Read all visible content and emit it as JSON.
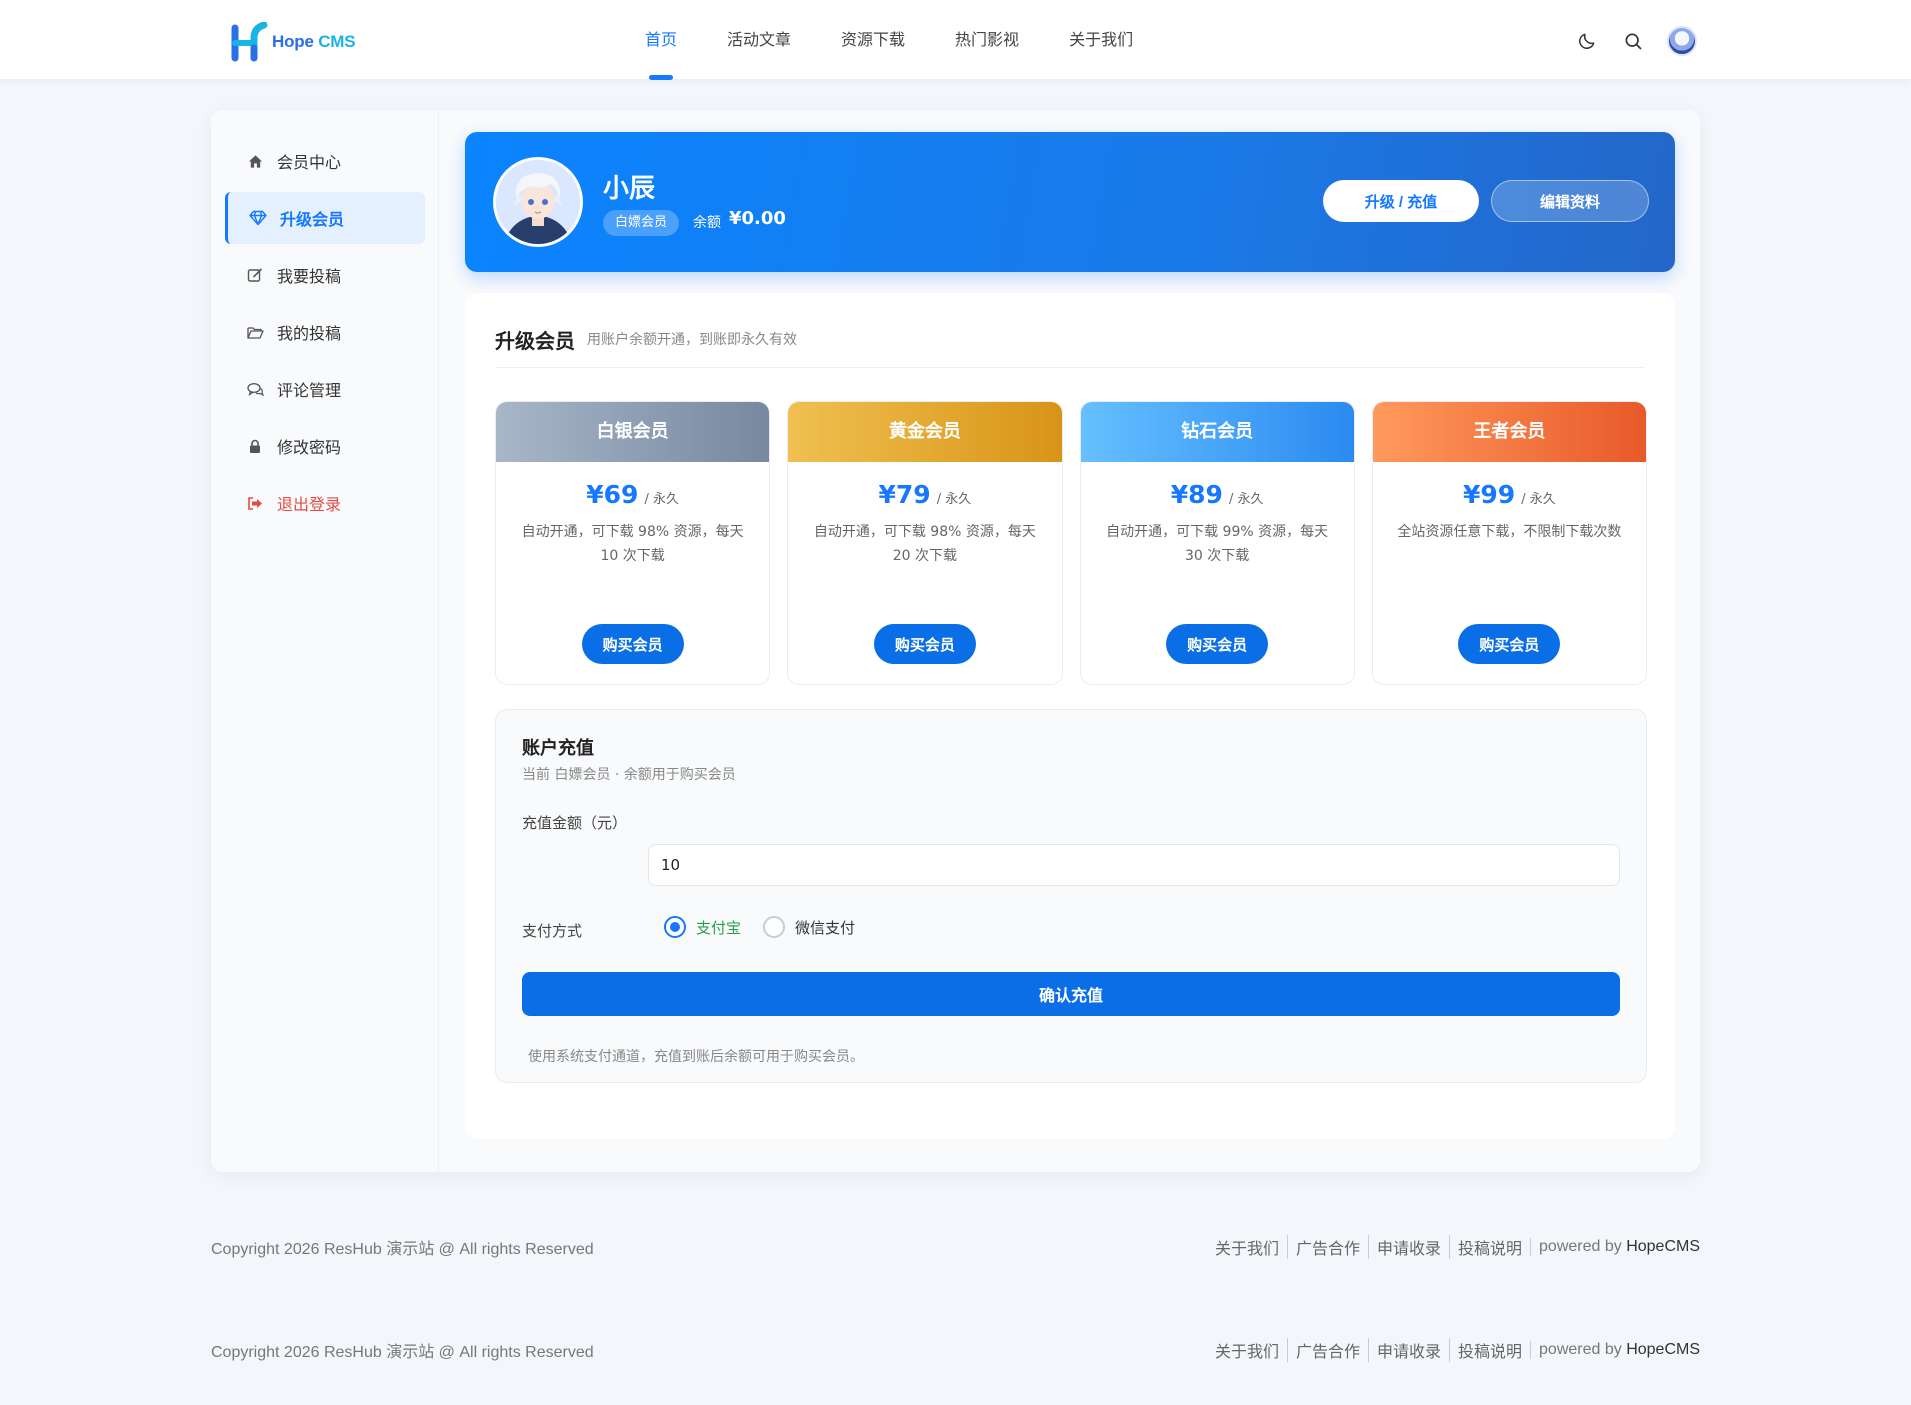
{
  "brand": {
    "logo_primary": "Hope",
    "logo_secondary": "CMS",
    "colors": {
      "primary": "#1677ff",
      "logo_blue": "#2a6ee8",
      "logo_cyan": "#18b4e6"
    }
  },
  "nav": {
    "items": [
      {
        "label": "首页",
        "active": true
      },
      {
        "label": "活动文章"
      },
      {
        "label": "资源下载"
      },
      {
        "label": "热门影视"
      },
      {
        "label": "关于我们"
      }
    ],
    "tools": {
      "theme_icon": "moon-icon",
      "search_icon": "search-icon",
      "avatar_icon": "user-avatar"
    }
  },
  "sidebar": {
    "items": [
      {
        "label": "会员中心",
        "icon": "home-icon"
      },
      {
        "label": "升级会员",
        "icon": "diamond-icon",
        "active": true
      },
      {
        "label": "我要投稿",
        "icon": "edit-icon"
      },
      {
        "label": "我的投稿",
        "icon": "folder-icon"
      },
      {
        "label": "评论管理",
        "icon": "comment-icon"
      },
      {
        "label": "修改密码",
        "icon": "lock-icon"
      },
      {
        "label": "退出登录",
        "icon": "logout-icon"
      }
    ]
  },
  "profile": {
    "name": "小辰",
    "badge": "白嫖会员",
    "balance_label": "余额",
    "balance": "¥0.00",
    "upgrade_button": "升级 / 充值",
    "edit_button": "编辑资料"
  },
  "upgrade": {
    "title": "升级会员",
    "subtitle": "用账户余额开通，到账即永久有效",
    "plans": [
      {
        "name": "白银会员",
        "price": "¥69",
        "period": "/ 永久",
        "desc": "自动开通，可下载 98% 资源，每天 10 次下载",
        "button": "购买会员",
        "gradient": [
          "#a8b6c8",
          "#7788a0"
        ]
      },
      {
        "name": "黄金会员",
        "price": "¥79",
        "period": "/ 永久",
        "desc": "自动开通，可下载 98% 资源，每天 20 次下载",
        "button": "购买会员",
        "gradient": [
          "#f0c050",
          "#d89418"
        ]
      },
      {
        "name": "钻石会员",
        "price": "¥89",
        "period": "/ 永久",
        "desc": "自动开通，可下载 99% 资源，每天 30 次下载",
        "button": "购买会员",
        "gradient": [
          "#66c0ff",
          "#2b8af0"
        ]
      },
      {
        "name": "王者会员",
        "price": "¥99",
        "period": "/ 永久",
        "desc": "全站资源任意下载，不限制下载次数",
        "button": "购买会员",
        "gradient": [
          "#ff9a5c",
          "#e8592a"
        ]
      }
    ]
  },
  "recharge": {
    "title": "账户充值",
    "subtitle": "当前 白嫖会员 · 余额用于购买会员",
    "amount_label": "充值金额（元）",
    "amount_value": "10",
    "pay_label": "支付方式",
    "pay_options": [
      {
        "label": "支付宝",
        "checked": true
      },
      {
        "label": "微信支付",
        "checked": false
      }
    ],
    "submit": "确认充值",
    "note": "使用系统支付通道，充值到账后余额可用于购买会员。"
  },
  "footer": {
    "copyright": "Copyright 2026 ResHub 演示站 @ All rights Reserved",
    "links": [
      "关于我们",
      "广告合作",
      "申请收录",
      "投稿说明"
    ],
    "powered_prefix": "powered by",
    "powered_name": "HopeCMS"
  }
}
